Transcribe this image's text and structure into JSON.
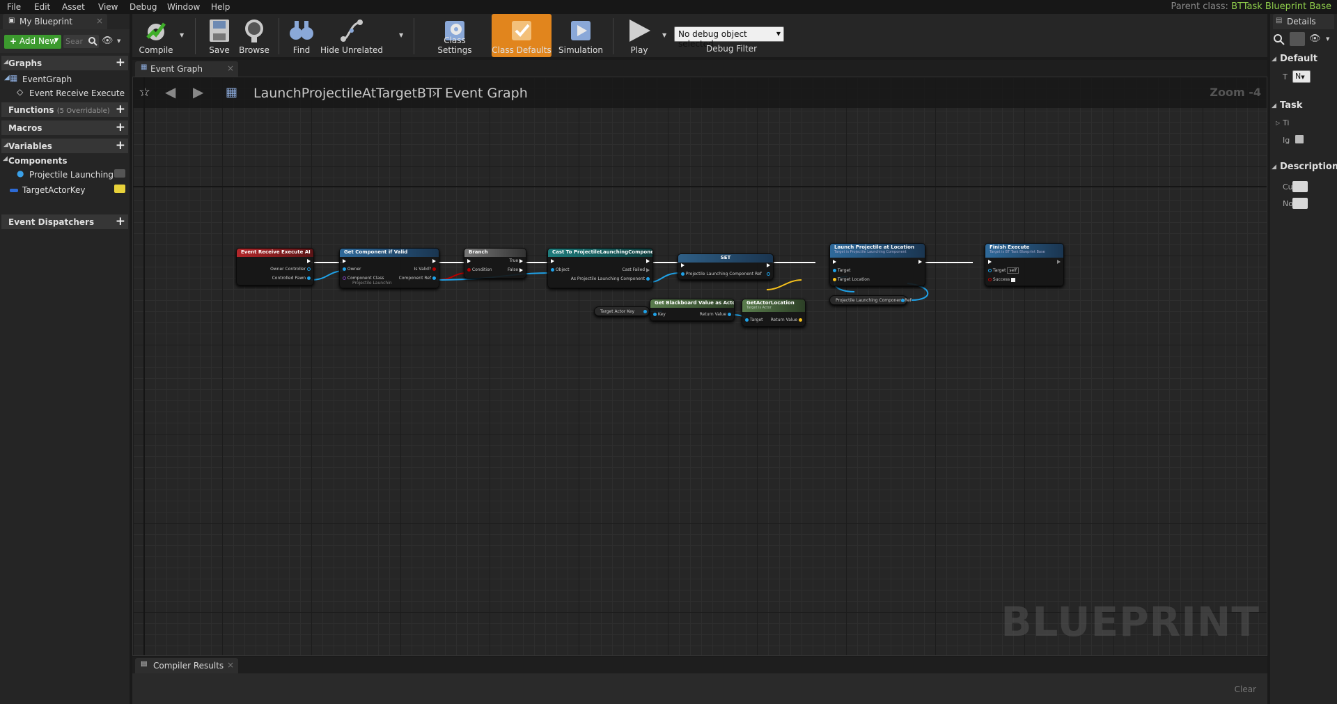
{
  "menu": [
    "File",
    "Edit",
    "Asset",
    "View",
    "Debug",
    "Window",
    "Help"
  ],
  "parent_class": {
    "label": "Parent class:",
    "value": "BTTask Blueprint Base"
  },
  "my_blueprint": {
    "tab_title": "My Blueprint",
    "add_new": "Add New",
    "search_placeholder": "Sear",
    "sections": {
      "graphs": "Graphs",
      "functions": "Functions",
      "functions_count": "(5 Overridable)",
      "macros": "Macros",
      "variables": "Variables",
      "components": "Components",
      "event_dispatchers": "Event Dispatchers"
    },
    "event_graph": "EventGraph",
    "event_receive_execute": "Event Receive Execute",
    "projectile_launching": "Projectile Launching",
    "target_actor_key": "TargetActorKey"
  },
  "toolbar": {
    "compile": "Compile",
    "save": "Save",
    "browse": "Browse",
    "find": "Find",
    "hide_unrelated": "Hide Unrelated",
    "class_settings": "Class Settings",
    "class_defaults": "Class Defaults",
    "simulation": "Simulation",
    "play": "Play",
    "debug_object": "No debug object selected",
    "debug_filter": "Debug Filter"
  },
  "graph": {
    "tab": "Event Graph",
    "breadcrumb_blueprint": "LaunchProjectileAtTargetBTT",
    "breadcrumb_graph": "Event Graph",
    "zoom": "Zoom -4",
    "watermark": "BLUEPRINT"
  },
  "nodes": {
    "event_receive": {
      "title": "Event Receive Execute AI",
      "pin1": "Owner Controller",
      "pin2": "Controlled Pawn"
    },
    "get_component": {
      "title": "Get Component if Valid",
      "pin_owner": "Owner",
      "pin_class": "Component Class",
      "pin_class_val": "Projectile Launchin",
      "pin_valid": "Is Valid?",
      "pin_ref": "Component Ref"
    },
    "branch": {
      "title": "Branch",
      "pin_cond": "Condition",
      "pin_true": "True",
      "pin_false": "False"
    },
    "cast": {
      "title": "Cast To ProjectileLaunchingComponent",
      "pin_obj": "Object",
      "pin_failed": "Cast Failed",
      "pin_as": "As Projectile Launching Component"
    },
    "set": {
      "title": "SET",
      "pin": "Projectile Launching Component Ref"
    },
    "launch": {
      "title": "Launch Projectile at Location",
      "subtitle": "Target is Projectile Launching Component",
      "pin_target": "Target",
      "pin_loc": "Target Location"
    },
    "finish": {
      "title": "Finish Execute",
      "subtitle": "Target is BT Task Blueprint Base",
      "pin_target": "Target",
      "pin_target_val": "self",
      "pin_success": "Success"
    },
    "bb_value": {
      "title": "Get Blackboard Value as Actor",
      "pin_key": "Key",
      "pin_ret": "Return Value"
    },
    "actor_location": {
      "title": "GetActorLocation",
      "subtitle": "Target is Actor",
      "pin_target": "Target",
      "pin_ret": "Return Value"
    },
    "target_actor_key_var": "Target Actor Key",
    "plc_ref_var": "Projectile Launching Component Ref"
  },
  "compiler": {
    "tab": "Compiler Results",
    "clear": "Clear"
  },
  "details": {
    "tab": "Details",
    "default": "Default",
    "task": "Task",
    "description": "Description",
    "t_label": "T",
    "t_value": "N",
    "ti_label": "Ti",
    "ig_label": "Ig",
    "cu_label": "Cu",
    "no_label": "No"
  },
  "colors": {
    "accent_orange": "#e1851d",
    "add_green": "#3c9a2e",
    "parent_green": "#8fce4b",
    "event_red": "#b3272a",
    "func_blue": "#2f6a9b",
    "pure_green": "#5a7d4d",
    "object_pin_blue": "#1fa2e8",
    "vector_pin_yellow": "#f7c21c",
    "bool_pin_red": "#b60000"
  }
}
